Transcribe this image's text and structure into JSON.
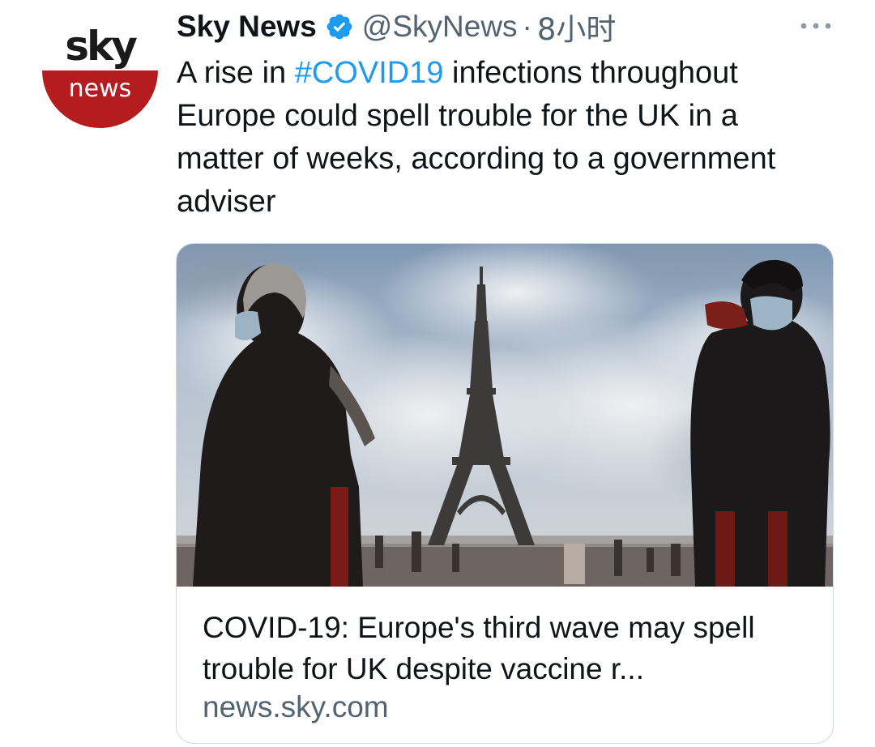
{
  "avatar": {
    "top_text": "sky",
    "bottom_text": "news",
    "brand_red": "#b51c20"
  },
  "header": {
    "display_name": "Sky News",
    "verified_icon": "verified-badge-icon",
    "handle": "@SkyNews",
    "separator": "·",
    "time": "8小时",
    "more_icon": "more-options-icon"
  },
  "tweet": {
    "text_before": "A rise in ",
    "hashtag": "#COVID19",
    "text_after": " infections throughout Europe could spell trouble for the UK in a matter of weeks, according to a government adviser"
  },
  "card": {
    "image_icon": "eiffel-tower-photo",
    "title": "COVID-19: Europe's third wave may spell trouble for UK despite vaccine r...",
    "domain": "news.sky.com"
  },
  "colors": {
    "link": "#1d9bf0",
    "muted": "#536471",
    "text": "#0f1419",
    "verified": "#1d9bf0"
  }
}
